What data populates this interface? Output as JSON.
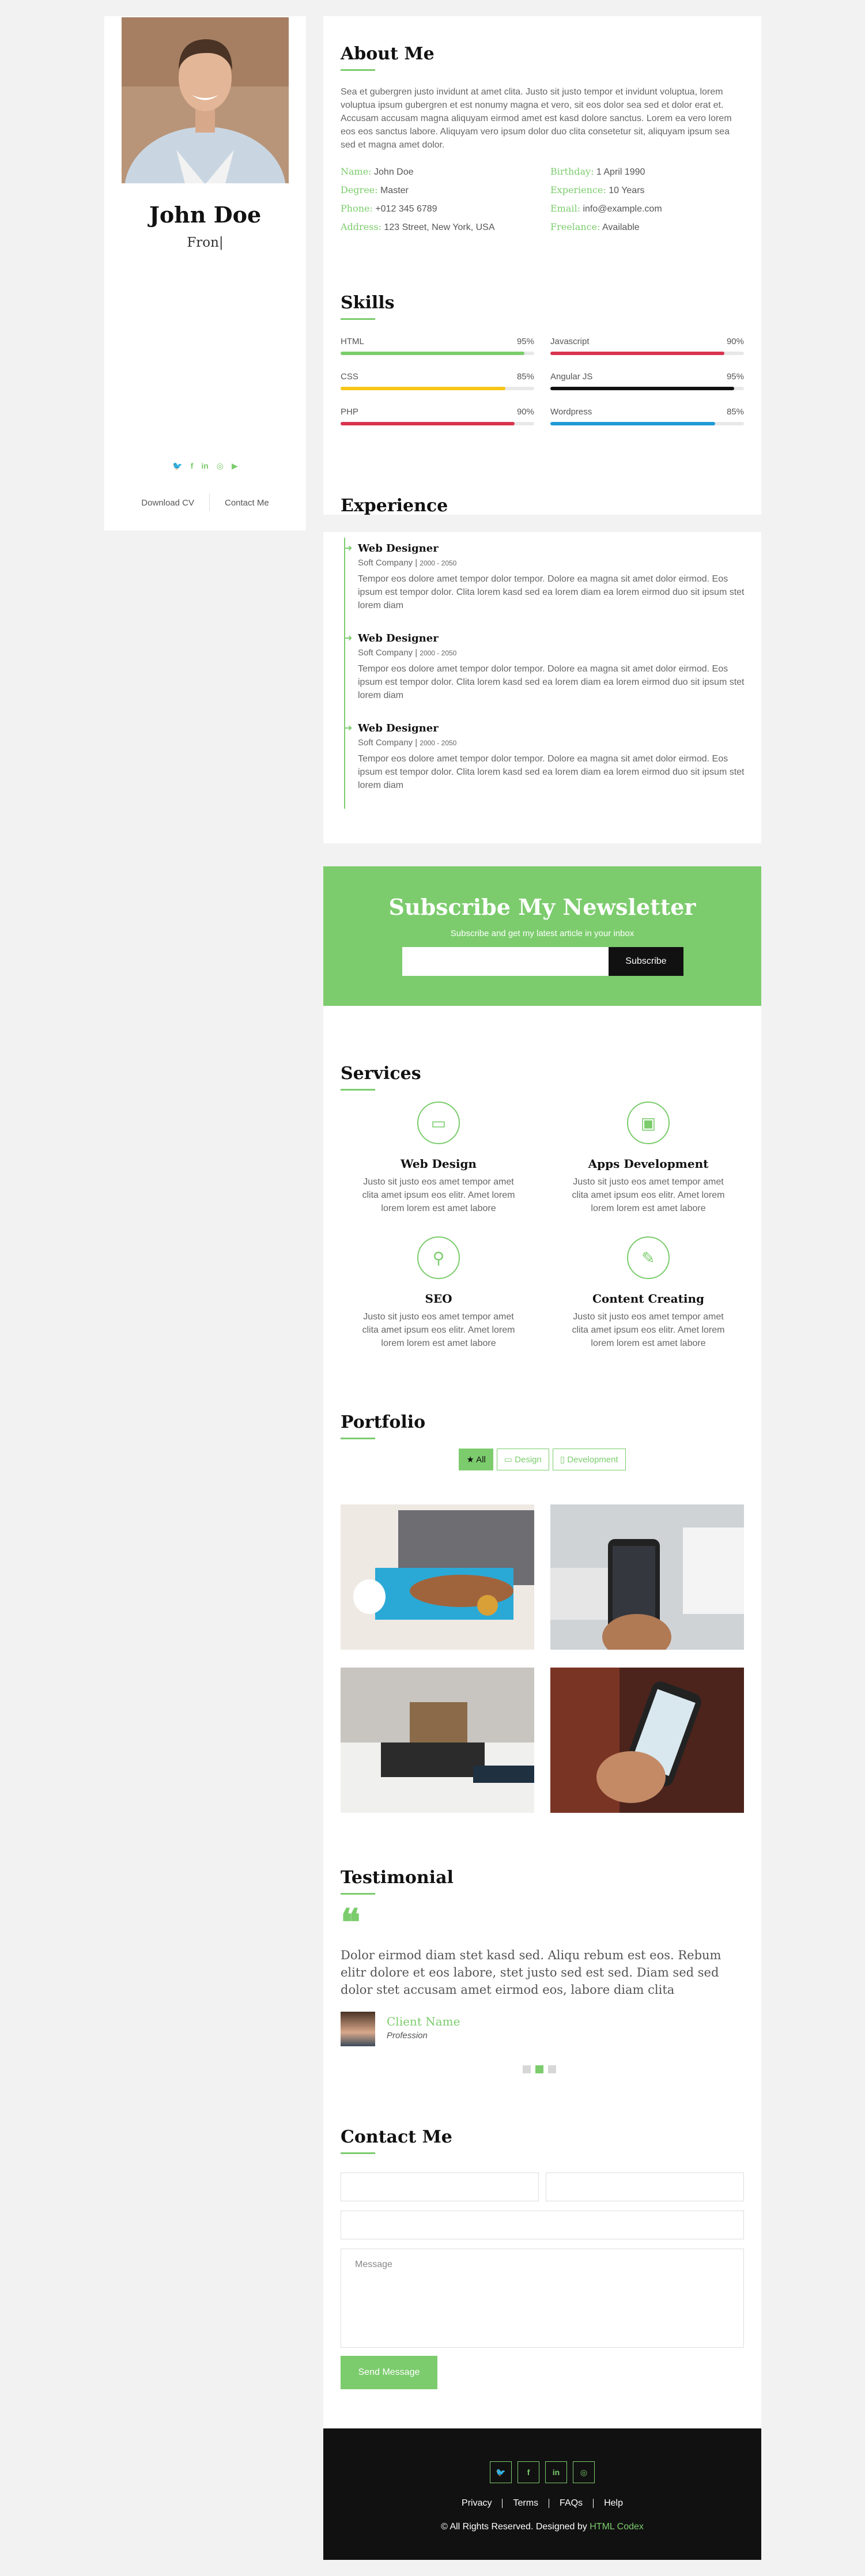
{
  "profile": {
    "name": "John Doe",
    "role": "Fron|",
    "download_cv": "Download CV",
    "contact_me": "Contact Me"
  },
  "sidebar_social": [
    "twitter-icon",
    "facebook-icon",
    "linkedin-icon",
    "instagram-icon",
    "youtube-icon"
  ],
  "about": {
    "title": "About Me",
    "text": "Sea et gubergren justo invidunt at amet clita. Justo sit justo tempor et invidunt voluptua, lorem voluptua ipsum gubergren et est nonumy magna et vero, sit eos dolor sea sed et dolor erat et. Accusam accusam magna aliquyam eirmod amet est kasd dolore sanctus. Lorem ea vero lorem eos eos sanctus labore. Aliquyam vero ipsum dolor duo clita consetetur sit, aliquyam ipsum sea sed et magna amet dolor.",
    "info": [
      {
        "label": "Name:",
        "value": "John Doe"
      },
      {
        "label": "Birthday:",
        "value": "1 April 1990"
      },
      {
        "label": "Degree:",
        "value": "Master"
      },
      {
        "label": "Experience:",
        "value": "10 Years"
      },
      {
        "label": "Phone:",
        "value": "+012 345 6789"
      },
      {
        "label": "Email:",
        "value": "info@example.com"
      },
      {
        "label": "Address:",
        "value": "123 Street, New York, USA"
      },
      {
        "label": "Freelance:",
        "value": "Available"
      }
    ]
  },
  "skills": {
    "title": "Skills",
    "items": [
      {
        "name": "HTML",
        "pct": "95%",
        "level": 0.95,
        "color": "#7ccc6d"
      },
      {
        "name": "Javascript",
        "pct": "90%",
        "level": 0.9,
        "color": "#d9344f"
      },
      {
        "name": "CSS",
        "pct": "85%",
        "level": 0.85,
        "color": "#f5c518"
      },
      {
        "name": "Angular JS",
        "pct": "95%",
        "level": 0.95,
        "color": "#111111"
      },
      {
        "name": "PHP",
        "pct": "90%",
        "level": 0.9,
        "color": "#d9344f"
      },
      {
        "name": "Wordpress",
        "pct": "85%",
        "level": 0.85,
        "color": "#1e9ad6"
      }
    ]
  },
  "experience": {
    "title": "Experience",
    "items": [
      {
        "title": "Web Designer",
        "company": "Soft Company",
        "years": "2000 - 2050",
        "text": "Tempor eos dolore amet tempor dolor tempor. Dolore ea magna sit amet dolor eirmod. Eos ipsum est tempor dolor. Clita lorem kasd sed ea lorem diam ea lorem eirmod duo sit ipsum stet lorem diam"
      },
      {
        "title": "Web Designer",
        "company": "Soft Company",
        "years": "2000 - 2050",
        "text": "Tempor eos dolore amet tempor dolor tempor. Dolore ea magna sit amet dolor eirmod. Eos ipsum est tempor dolor. Clita lorem kasd sed ea lorem diam ea lorem eirmod duo sit ipsum stet lorem diam"
      },
      {
        "title": "Web Designer",
        "company": "Soft Company",
        "years": "2000 - 2050",
        "text": "Tempor eos dolore amet tempor dolor tempor. Dolore ea magna sit amet dolor eirmod. Eos ipsum est tempor dolor. Clita lorem kasd sed ea lorem diam ea lorem eirmod duo sit ipsum stet lorem diam"
      }
    ]
  },
  "newsletter": {
    "title": "Subscribe My Newsletter",
    "subtitle": "Subscribe and get my latest article in your inbox",
    "button": "Subscribe"
  },
  "services": {
    "title": "Services",
    "items": [
      {
        "icon": "laptop-icon",
        "title": "Web Design",
        "text": "Justo sit justo eos amet tempor amet clita amet ipsum eos elitr. Amet lorem lorem lorem est amet labore"
      },
      {
        "icon": "android-icon",
        "title": "Apps Development",
        "text": "Justo sit justo eos amet tempor amet clita amet ipsum eos elitr. Amet lorem lorem lorem est amet labore"
      },
      {
        "icon": "search-icon",
        "title": "SEO",
        "text": "Justo sit justo eos amet tempor amet clita amet ipsum eos elitr. Amet lorem lorem lorem est amet labore"
      },
      {
        "icon": "edit-icon",
        "title": "Content Creating",
        "text": "Justo sit justo eos amet tempor amet clita amet ipsum eos elitr. Amet lorem lorem lorem est amet labore"
      }
    ]
  },
  "portfolio": {
    "title": "Portfolio",
    "filters": [
      "All",
      "Design",
      "Development"
    ]
  },
  "testimonial": {
    "title": "Testimonial",
    "quote": "Dolor eirmod diam stet kasd sed. Aliqu rebum est eos. Rebum elitr dolore et eos labore, stet justo sed est sed. Diam sed sed dolor stet accusam amet eirmod eos, labore diam clita",
    "client": "Client Name",
    "profession": "Profession"
  },
  "contact": {
    "title": "Contact Me",
    "message_placeholder": "Message",
    "button": "Send Message"
  },
  "footer": {
    "menu": [
      "Privacy",
      "Terms",
      "FAQs",
      "Help"
    ],
    "copy": "© All Rights Reserved. Designed by",
    "brand": "HTML Codex"
  },
  "colors": {
    "accent": "#7ccc6d",
    "dark": "#111111"
  }
}
